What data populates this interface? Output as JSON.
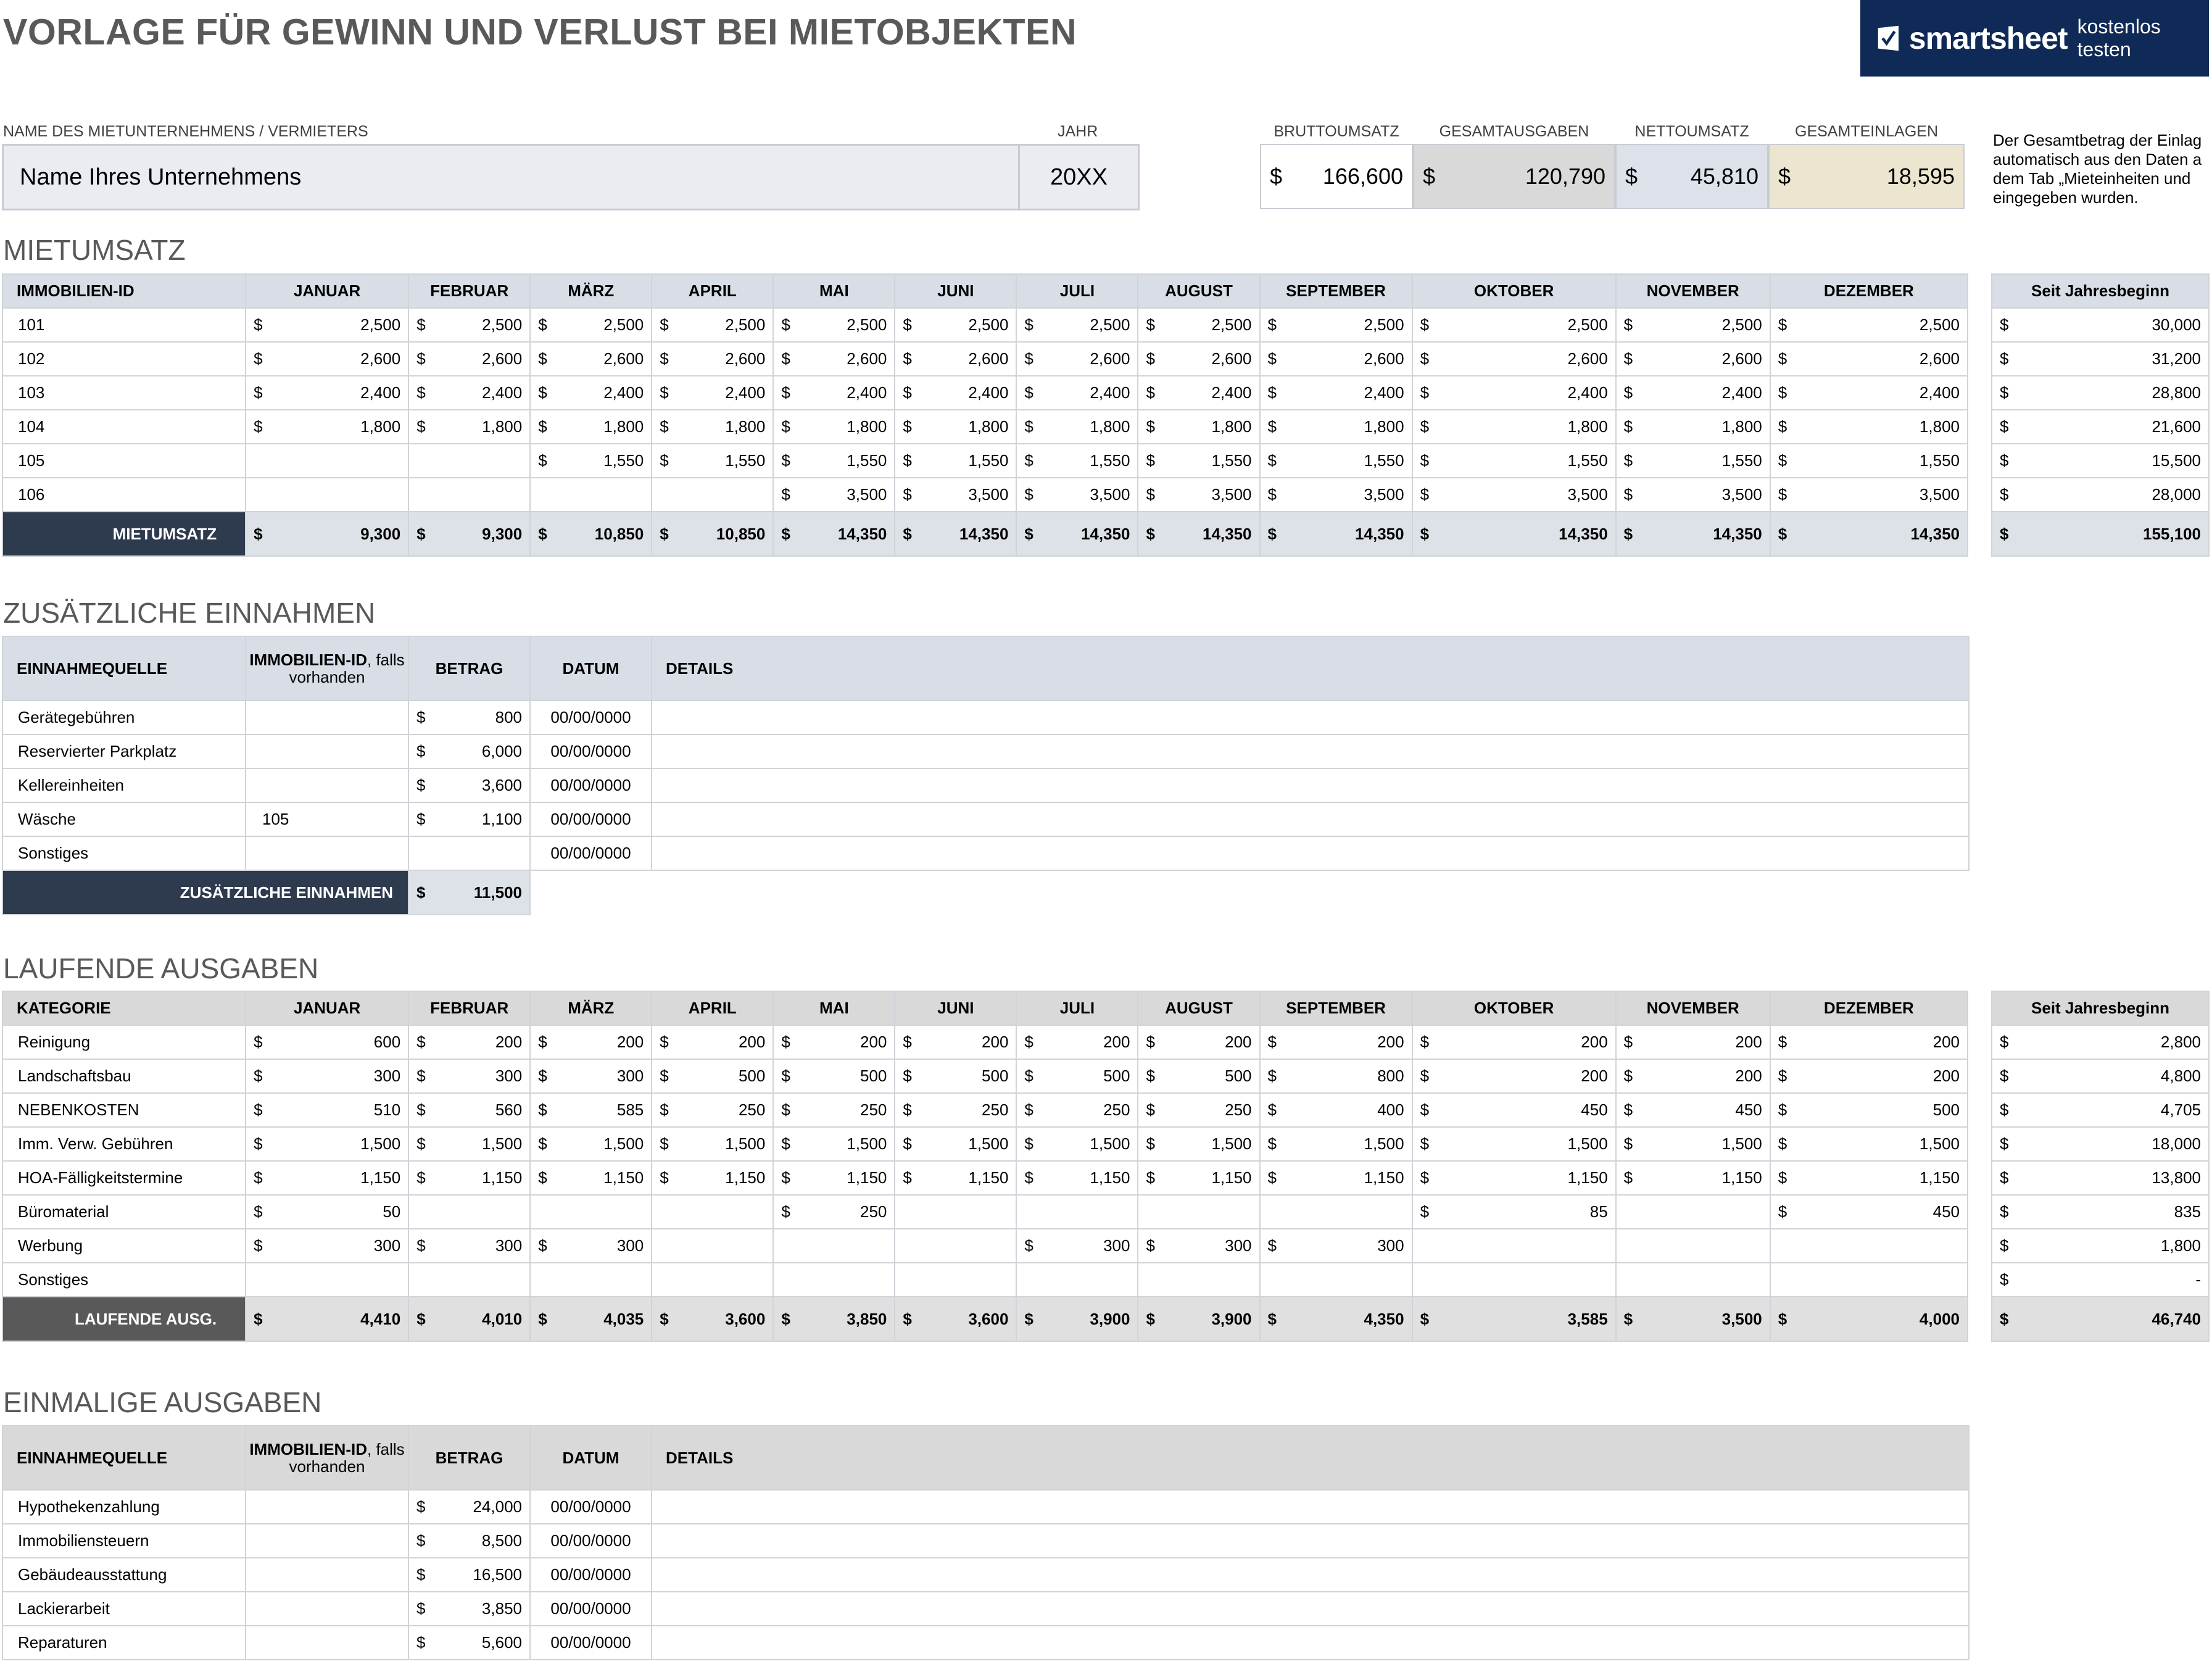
{
  "title": "VORLAGE FÜR GEWINN UND VERLUST BEI MIETOBJEKTEN",
  "logo": {
    "brand": "smartsheet",
    "cta": "kostenlos testen"
  },
  "header": {
    "company_label": "NAME DES MIETUNTERNEHMENS / VERMIETERS",
    "company_value": "Name Ihres Unternehmens",
    "year_label": "JAHR",
    "year_value": "20XX",
    "summary": [
      {
        "label": "BRUTTOUMSATZ",
        "cur": "$",
        "value": "166,600",
        "color": "#ffffff"
      },
      {
        "label": "GESAMTAUSGABEN",
        "cur": "$",
        "value": "120,790",
        "color": "#d9d9d9"
      },
      {
        "label": "NETTOUMSATZ",
        "cur": "$",
        "value": "45,810",
        "color": "#dde1ea"
      },
      {
        "label": "GESAMTEINLAGEN",
        "cur": "$",
        "value": "18,595",
        "color": "#ece5cf"
      }
    ],
    "note": "Der Gesamtbetrag der Einlag automatisch aus den Daten a dem Tab „Mieteinheiten und eingegeben wurden."
  },
  "months": [
    "JANUAR",
    "FEBRUAR",
    "MÄRZ",
    "APRIL",
    "MAI",
    "JUNI",
    "JULI",
    "AUGUST",
    "SEPTEMBER",
    "OKTOBER",
    "NOVEMBER",
    "DEZEMBER"
  ],
  "ytd_label": "Seit Jahresbeginn",
  "rent": {
    "section_title": "MIETUMSATZ",
    "first_col": "IMMOBILIEN-ID",
    "rows": [
      {
        "id": "101",
        "values": [
          "2,500",
          "2,500",
          "2,500",
          "2,500",
          "2,500",
          "2,500",
          "2,500",
          "2,500",
          "2,500",
          "2,500",
          "2,500",
          "2,500"
        ],
        "ytd": "30,000"
      },
      {
        "id": "102",
        "values": [
          "2,600",
          "2,600",
          "2,600",
          "2,600",
          "2,600",
          "2,600",
          "2,600",
          "2,600",
          "2,600",
          "2,600",
          "2,600",
          "2,600"
        ],
        "ytd": "31,200"
      },
      {
        "id": "103",
        "values": [
          "2,400",
          "2,400",
          "2,400",
          "2,400",
          "2,400",
          "2,400",
          "2,400",
          "2,400",
          "2,400",
          "2,400",
          "2,400",
          "2,400"
        ],
        "ytd": "28,800"
      },
      {
        "id": "104",
        "values": [
          "1,800",
          "1,800",
          "1,800",
          "1,800",
          "1,800",
          "1,800",
          "1,800",
          "1,800",
          "1,800",
          "1,800",
          "1,800",
          "1,800"
        ],
        "ytd": "21,600"
      },
      {
        "id": "105",
        "values": [
          "",
          "",
          "1,550",
          "1,550",
          "1,550",
          "1,550",
          "1,550",
          "1,550",
          "1,550",
          "1,550",
          "1,550",
          "1,550"
        ],
        "ytd": "15,500"
      },
      {
        "id": "106",
        "values": [
          "",
          "",
          "",
          "",
          "3,500",
          "3,500",
          "3,500",
          "3,500",
          "3,500",
          "3,500",
          "3,500",
          "3,500"
        ],
        "ytd": "28,000"
      }
    ],
    "total_label": "MIETUMSATZ",
    "totals": [
      "9,300",
      "9,300",
      "10,850",
      "10,850",
      "14,350",
      "14,350",
      "14,350",
      "14,350",
      "14,350",
      "14,350",
      "14,350",
      "14,350"
    ],
    "total_ytd": "155,100"
  },
  "extra": {
    "section_title": "ZUSÄTZLICHE EINNAHMEN",
    "headers": {
      "source": "EINNAHMEQUELLE",
      "prop_bold": "IMMOBILIEN-ID",
      "prop_rest": ", falls vorhanden",
      "amount": "BETRAG",
      "date": "DATUM",
      "details": "DETAILS"
    },
    "rows": [
      {
        "source": "Gerätegebühren",
        "prop": "",
        "amount": "800",
        "date": "00/00/0000"
      },
      {
        "source": "Reservierter Parkplatz",
        "prop": "",
        "amount": "6,000",
        "date": "00/00/0000"
      },
      {
        "source": "Kellereinheiten",
        "prop": "",
        "amount": "3,600",
        "date": "00/00/0000"
      },
      {
        "source": "Wäsche",
        "prop": "105",
        "amount": "1,100",
        "date": "00/00/0000"
      },
      {
        "source": "Sonstiges",
        "prop": "",
        "amount": "",
        "date": "00/00/0000"
      }
    ],
    "total_label": "ZUSÄTZLICHE EINNAHMEN",
    "total": "11,500"
  },
  "running": {
    "section_title": "LAUFENDE AUSGABEN",
    "first_col": "KATEGORIE",
    "rows": [
      {
        "name": "Reinigung",
        "values": [
          "600",
          "200",
          "200",
          "200",
          "200",
          "200",
          "200",
          "200",
          "200",
          "200",
          "200",
          "200"
        ],
        "ytd": "2,800"
      },
      {
        "name": "Landschaftsbau",
        "values": [
          "300",
          "300",
          "300",
          "500",
          "500",
          "500",
          "500",
          "500",
          "800",
          "200",
          "200",
          "200"
        ],
        "ytd": "4,800"
      },
      {
        "name": "NEBENKOSTEN",
        "values": [
          "510",
          "560",
          "585",
          "250",
          "250",
          "250",
          "250",
          "250",
          "400",
          "450",
          "450",
          "500"
        ],
        "ytd": "4,705"
      },
      {
        "name": "Imm. Verw. Gebühren",
        "values": [
          "1,500",
          "1,500",
          "1,500",
          "1,500",
          "1,500",
          "1,500",
          "1,500",
          "1,500",
          "1,500",
          "1,500",
          "1,500",
          "1,500"
        ],
        "ytd": "18,000"
      },
      {
        "name": "HOA-Fälligkeitstermine",
        "values": [
          "1,150",
          "1,150",
          "1,150",
          "1,150",
          "1,150",
          "1,150",
          "1,150",
          "1,150",
          "1,150",
          "1,150",
          "1,150",
          "1,150"
        ],
        "ytd": "13,800"
      },
      {
        "name": "Büromaterial",
        "values": [
          "50",
          "",
          "",
          "",
          "250",
          "",
          "",
          "",
          "",
          "85",
          "",
          "450"
        ],
        "ytd": "835"
      },
      {
        "name": "Werbung",
        "values": [
          "300",
          "300",
          "300",
          "",
          "",
          "",
          "300",
          "300",
          "300",
          "",
          "",
          ""
        ],
        "ytd": "1,800"
      },
      {
        "name": "Sonstiges",
        "values": [
          "",
          "",
          "",
          "",
          "",
          "",
          "",
          "",
          "",
          "",
          "",
          ""
        ],
        "ytd": "-"
      }
    ],
    "total_label": "LAUFENDE AUSG.",
    "totals": [
      "4,410",
      "4,010",
      "4,035",
      "3,600",
      "3,850",
      "3,600",
      "3,900",
      "3,900",
      "4,350",
      "3,585",
      "3,500",
      "4,000"
    ],
    "total_ytd": "46,740"
  },
  "onetime": {
    "section_title": "EINMALIGE AUSGABEN",
    "headers": {
      "source": "EINNAHMEQUELLE",
      "prop_bold": "IMMOBILIEN-ID",
      "prop_rest": ", falls vorhanden",
      "amount": "BETRAG",
      "date": "DATUM",
      "details": "DETAILS"
    },
    "rows": [
      {
        "source": "Hypothekenzahlung",
        "prop": "",
        "amount": "24,000",
        "date": "00/00/0000"
      },
      {
        "source": "Immobiliensteuern",
        "prop": "",
        "amount": "8,500",
        "date": "00/00/0000"
      },
      {
        "source": "Gebäudeausstattung",
        "prop": "",
        "amount": "16,500",
        "date": "00/00/0000"
      },
      {
        "source": "Lackierarbeit",
        "prop": "",
        "amount": "3,850",
        "date": "00/00/0000"
      },
      {
        "source": "Reparaturen",
        "prop": "",
        "amount": "5,600",
        "date": "00/00/0000"
      }
    ]
  },
  "currency": "$"
}
